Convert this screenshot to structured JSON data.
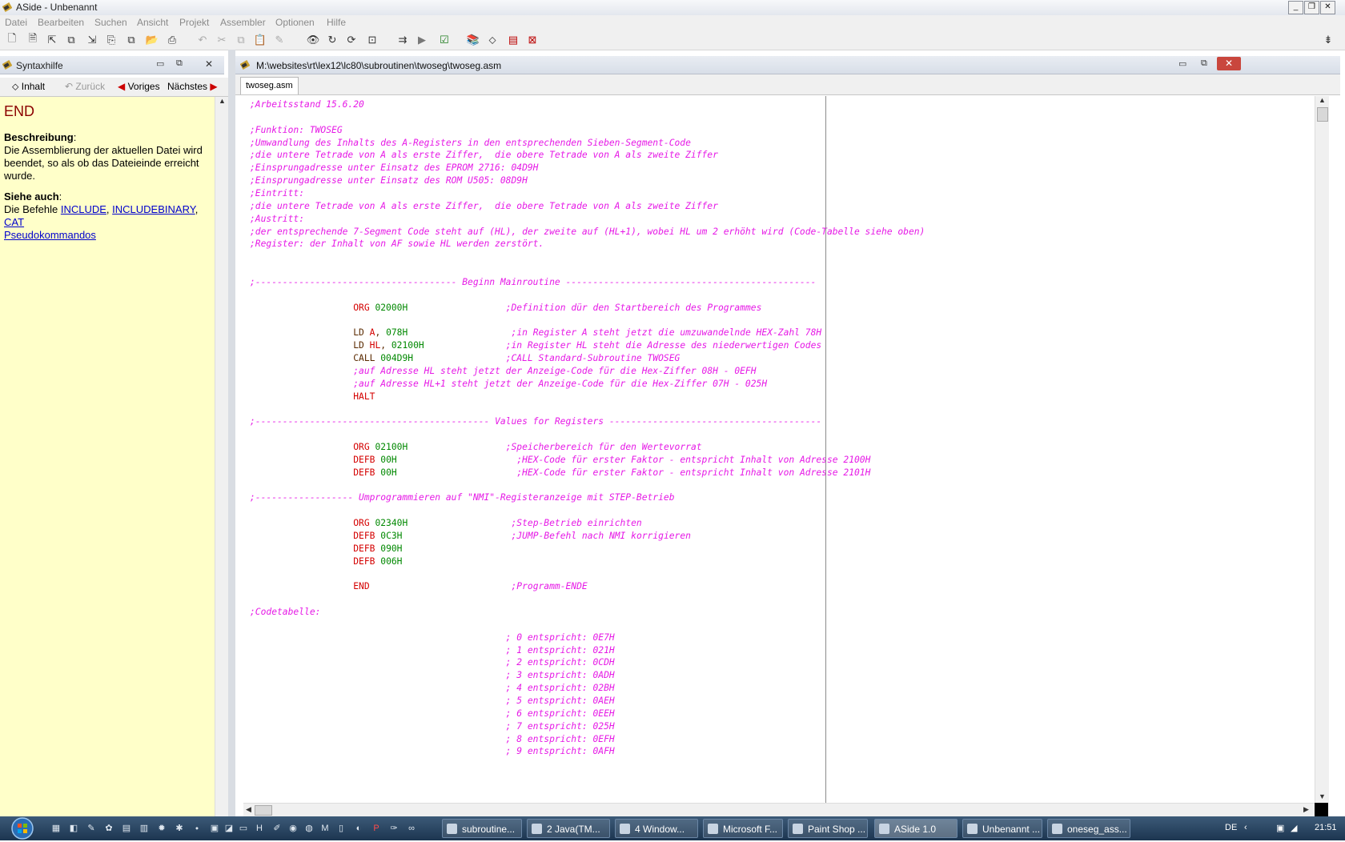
{
  "window": {
    "title": "ASide - Unbenannt"
  },
  "menu": [
    "Datei",
    "Bearbeiten",
    "Suchen",
    "Ansicht",
    "Projekt",
    "Assembler",
    "Optionen",
    "Hilfe"
  ],
  "help_panel": {
    "title": "Syntaxhilfe",
    "nav": {
      "contents": "Inhalt",
      "back": "Zurück",
      "prev": "Voriges",
      "next": "Nächstes"
    },
    "keyword": "END",
    "desc_heading": "Beschreibung",
    "desc_text": "Die Assemblierung der aktuellen Datei wird beendet, so als ob das Dateieinde erreicht wurde.",
    "see_heading": "Siehe auch",
    "see_prefix": "Die Befehle",
    "links": [
      "INCLUDE",
      "INCLUDEBINARY",
      "CAT",
      "Pseudokommandos"
    ]
  },
  "editor": {
    "path": "M:\\websites\\rt\\lex12\\lc80\\subroutinen\\twoseg\\twoseg.asm",
    "tab": "twoseg.asm",
    "lines": [
      [
        [
          "c",
          ";Arbeitsstand 15.6.20"
        ]
      ],
      [],
      [
        [
          "c",
          ";Funktion: TWOSEG"
        ]
      ],
      [
        [
          "c",
          ";Umwandlung des Inhalts des A-Registers in den entsprechenden Sieben-Segment-Code"
        ]
      ],
      [
        [
          "c",
          ";die untere Tetrade von A als erste Ziffer,  die obere Tetrade von A als zweite Ziffer"
        ]
      ],
      [
        [
          "c",
          ";Einsprungadresse unter Einsatz des EPROM 2716: 04D9H"
        ]
      ],
      [
        [
          "c",
          ";Einsprungadresse unter Einsatz des ROM U505: 08D9H"
        ]
      ],
      [
        [
          "c",
          ";Eintritt:"
        ]
      ],
      [
        [
          "c",
          ";die untere Tetrade von A als erste Ziffer,  die obere Tetrade von A als zweite Ziffer"
        ]
      ],
      [
        [
          "c",
          ";Austritt:"
        ]
      ],
      [
        [
          "c",
          ";der entsprechende 7-Segment Code steht auf (HL), der zweite auf (HL+1), wobei HL um 2 erhöht wird (Code-Tabelle siehe oben)"
        ]
      ],
      [
        [
          "c",
          ";Register: der Inhalt von AF sowie HL werden zerstört."
        ]
      ],
      [],
      [],
      [
        [
          "c",
          ";------------------------------------- Beginn Mainroutine ----------------------------------------------"
        ]
      ],
      [],
      [
        [
          "t",
          "                   "
        ],
        [
          "k",
          "ORG"
        ],
        [
          "t",
          " "
        ],
        [
          "n",
          "02000H"
        ],
        [
          "t",
          "                  "
        ],
        [
          "c",
          ";Definition dür den Startbereich des Programmes"
        ]
      ],
      [],
      [
        [
          "t",
          "                   "
        ],
        [
          "p",
          "LD "
        ],
        [
          "k",
          "A"
        ],
        [
          "p",
          ", "
        ],
        [
          "n",
          "078H"
        ],
        [
          "t",
          "                   "
        ],
        [
          "c",
          ";in Register A steht jetzt die umzuwandelnde HEX-Zahl 78H"
        ]
      ],
      [
        [
          "t",
          "                   "
        ],
        [
          "p",
          "LD "
        ],
        [
          "k",
          "HL"
        ],
        [
          "p",
          ", "
        ],
        [
          "n",
          "02100H"
        ],
        [
          "t",
          "               "
        ],
        [
          "c",
          ";in Register HL steht die Adresse des niederwertigen Codes"
        ]
      ],
      [
        [
          "t",
          "                   "
        ],
        [
          "p",
          "CALL "
        ],
        [
          "n",
          "004D9H"
        ],
        [
          "t",
          "                 "
        ],
        [
          "c",
          ";CALL Standard-Subroutine TWOSEG"
        ]
      ],
      [
        [
          "t",
          "                   "
        ],
        [
          "c",
          ";auf Adresse HL steht jetzt der Anzeige-Code für die Hex-Ziffer 08H - 0EFH"
        ]
      ],
      [
        [
          "t",
          "                   "
        ],
        [
          "c",
          ";auf Adresse HL+1 steht jetzt der Anzeige-Code für die Hex-Ziffer 07H - 025H"
        ]
      ],
      [
        [
          "t",
          "                   "
        ],
        [
          "k",
          "HALT"
        ]
      ],
      [],
      [
        [
          "c",
          ";------------------------------------------- Values for Registers ---------------------------------------"
        ]
      ],
      [],
      [
        [
          "t",
          "                   "
        ],
        [
          "k",
          "ORG"
        ],
        [
          "t",
          " "
        ],
        [
          "n",
          "02100H"
        ],
        [
          "t",
          "                  "
        ],
        [
          "c",
          ";Speicherbereich für den Wertevorrat"
        ]
      ],
      [
        [
          "t",
          "                   "
        ],
        [
          "k",
          "DEFB"
        ],
        [
          "t",
          " "
        ],
        [
          "n",
          "00H"
        ],
        [
          "t",
          "                      "
        ],
        [
          "c",
          ";HEX-Code für erster Faktor - entspricht Inhalt von Adresse 2100H"
        ]
      ],
      [
        [
          "t",
          "                   "
        ],
        [
          "k",
          "DEFB"
        ],
        [
          "t",
          " "
        ],
        [
          "n",
          "00H"
        ],
        [
          "t",
          "                      "
        ],
        [
          "c",
          ";HEX-Code für erster Faktor - entspricht Inhalt von Adresse 2101H"
        ]
      ],
      [],
      [
        [
          "c",
          ";------------------ Umprogrammieren auf \"NMI\"-Registeranzeige mit STEP-Betrieb"
        ]
      ],
      [],
      [
        [
          "t",
          "                   "
        ],
        [
          "k",
          "ORG"
        ],
        [
          "t",
          " "
        ],
        [
          "n",
          "02340H"
        ],
        [
          "t",
          "                   "
        ],
        [
          "c",
          ";Step-Betrieb einrichten"
        ]
      ],
      [
        [
          "t",
          "                   "
        ],
        [
          "k",
          "DEFB"
        ],
        [
          "t",
          " "
        ],
        [
          "n",
          "0C3H"
        ],
        [
          "t",
          "                    "
        ],
        [
          "c",
          ";JUMP-Befehl nach NMI korrigieren"
        ]
      ],
      [
        [
          "t",
          "                   "
        ],
        [
          "k",
          "DEFB"
        ],
        [
          "t",
          " "
        ],
        [
          "n",
          "090H"
        ]
      ],
      [
        [
          "t",
          "                   "
        ],
        [
          "k",
          "DEFB"
        ],
        [
          "t",
          " "
        ],
        [
          "n",
          "006H"
        ]
      ],
      [],
      [
        [
          "t",
          "                   "
        ],
        [
          "k",
          "END"
        ],
        [
          "t",
          "                          "
        ],
        [
          "c",
          ";Programm-ENDE"
        ]
      ],
      [],
      [
        [
          "c",
          ";Codetabelle:"
        ]
      ],
      [],
      [
        [
          "t",
          "                                               "
        ],
        [
          "c",
          "; 0 entspricht: 0E7H"
        ]
      ],
      [
        [
          "t",
          "                                               "
        ],
        [
          "c",
          "; 1 entspricht: 021H"
        ]
      ],
      [
        [
          "t",
          "                                               "
        ],
        [
          "c",
          "; 2 entspricht: 0CDH"
        ]
      ],
      [
        [
          "t",
          "                                               "
        ],
        [
          "c",
          "; 3 entspricht: 0ADH"
        ]
      ],
      [
        [
          "t",
          "                                               "
        ],
        [
          "c",
          "; 4 entspricht: 02BH"
        ]
      ],
      [
        [
          "t",
          "                                               "
        ],
        [
          "c",
          "; 5 entspricht: 0AEH"
        ]
      ],
      [
        [
          "t",
          "                                               "
        ],
        [
          "c",
          "; 6 entspricht: 0EEH"
        ]
      ],
      [
        [
          "t",
          "                                               "
        ],
        [
          "c",
          "; 7 entspricht: 025H"
        ]
      ],
      [
        [
          "t",
          "                                               "
        ],
        [
          "c",
          "; 8 entspricht: 0EFH"
        ]
      ],
      [
        [
          "t",
          "                                               "
        ],
        [
          "c",
          "; 9 entspricht: 0AFH"
        ]
      ]
    ]
  },
  "taskbar": {
    "tasks": [
      "subroutine...",
      "2 Java(TM...",
      "4 Window...",
      "Microsoft F...",
      "Paint Shop ...",
      "ASide 1.0",
      "Unbenannt ...",
      "oneseg_ass..."
    ],
    "lang": "DE",
    "clock": "21:51"
  },
  "colors": {
    "comment": "#e619e6",
    "keyword": "#d40000",
    "number": "#008800",
    "help_bg": "#ffffc9"
  }
}
